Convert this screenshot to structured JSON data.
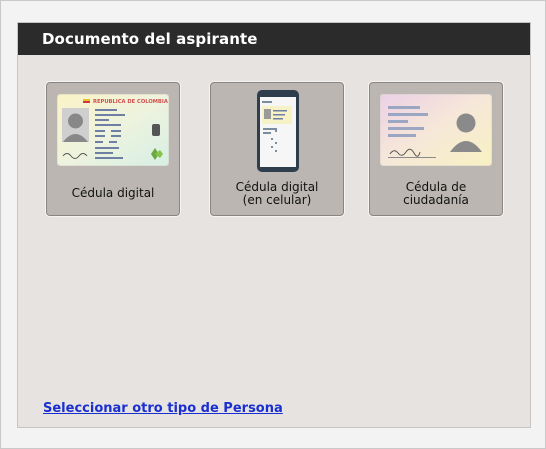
{
  "panel": {
    "title": "Documento del aspirante"
  },
  "options": [
    {
      "label_line1": "Cédula digital",
      "label_line2": "",
      "icon": "digital-id-card-icon",
      "card_header_text": "REPUBLICA DE COLOMBIA"
    },
    {
      "label_line1": "Cédula digital",
      "label_line2": "(en celular)",
      "icon": "phone-digital-id-icon"
    },
    {
      "label_line1": "Cédula de",
      "label_line2": "ciudadanía",
      "icon": "citizenship-id-card-icon"
    }
  ],
  "footer": {
    "link_text": "Seleccionar otro tipo de Persona"
  },
  "colors": {
    "header_bg": "#2b2b2b",
    "panel_bg": "#e6e3e1",
    "tile_bg": "#bbb6b1",
    "link": "#1a2fd0"
  }
}
